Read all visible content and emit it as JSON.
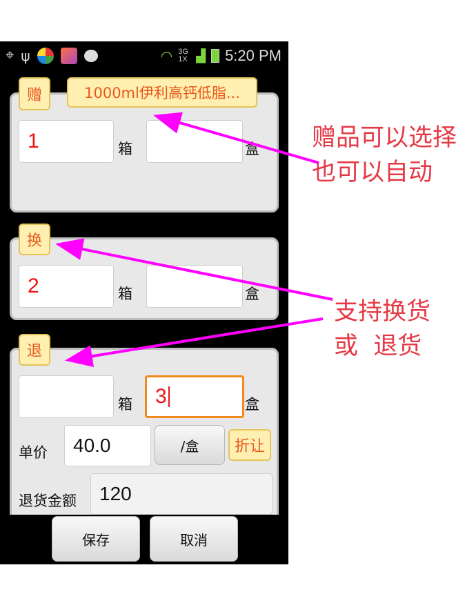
{
  "statusbar": {
    "net": "3G 1X",
    "time": "5:20 PM"
  },
  "gift": {
    "tag": "赠",
    "product": "1000ml伊利高钙低脂...",
    "qty_box": "1",
    "box_unit": "箱",
    "qty_piece": "",
    "piece_unit": "盒"
  },
  "exchange": {
    "tag": "换",
    "qty_box": "2",
    "box_unit": "箱",
    "qty_piece": "",
    "piece_unit": "盒"
  },
  "refund": {
    "tag": "退",
    "qty_box": "",
    "box_unit": "箱",
    "qty_piece": "3",
    "piece_unit": "盒",
    "price_label": "单价",
    "price": "40.0",
    "unit_button": "/盒",
    "discount_button": "折让",
    "amount_label": "退货金额",
    "amount": "120"
  },
  "footer": {
    "save": "保存",
    "cancel": "取消"
  },
  "annotations": {
    "line1": "赠品可以选择",
    "line2": "也可以自动",
    "line3": "支持换货",
    "line4": "或  退货"
  },
  "colors": {
    "annotation": "#e63946",
    "arrow": "#ff00ff",
    "tag_text": "#e8581c"
  }
}
